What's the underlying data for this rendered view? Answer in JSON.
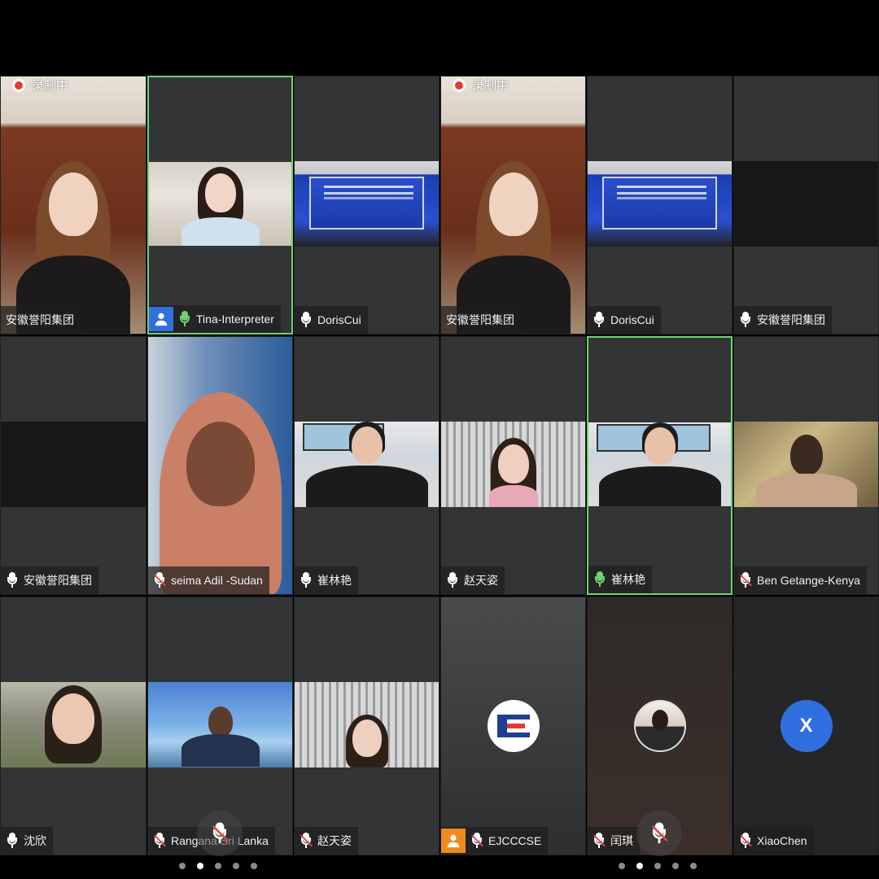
{
  "recording_label": "录制中",
  "colors": {
    "tile_bg": "#333436",
    "active_border": "#6fd36f",
    "muted_red": "#e04848",
    "badge_blue": "#2f6fe0",
    "badge_orange": "#f18a1e"
  },
  "left_panel": {
    "tiles": [
      {
        "name": "安徽誉阳集团",
        "mic": "on",
        "scene": "office-woman"
      },
      {
        "name": "Tina-Interpreter",
        "mic": "on-green",
        "scene": "shelf-woman",
        "badge": "user-icon"
      },
      {
        "name": "DorisCui",
        "mic": "on",
        "scene": "stage-banner"
      },
      {
        "name": "安徽誉阳集团",
        "mic": "on",
        "scene": "dark"
      },
      {
        "name": "seima Adil -Sudan",
        "mic": "muted",
        "scene": "hijab-woman"
      },
      {
        "name": "崔林艳",
        "mic": "on",
        "scene": "map-woman"
      },
      {
        "name": "沈欣",
        "mic": "on",
        "scene": "outdoor-woman"
      },
      {
        "name": "Rangana Sri Lanka",
        "mic": "muted",
        "scene": "sky-man"
      },
      {
        "name": "赵天姿",
        "mic": "muted",
        "scene": "ceiling-woman"
      }
    ],
    "pager": {
      "total": 5,
      "current": 2
    }
  },
  "right_panel": {
    "tiles": [
      {
        "name": "安徽誉阳集团",
        "mic": "none",
        "scene": "office-woman"
      },
      {
        "name": "DorisCui",
        "mic": "on",
        "scene": "stage-banner"
      },
      {
        "name": "安徽誉阳集团",
        "mic": "on",
        "scene": "dark"
      },
      {
        "name": "赵天姿",
        "mic": "on",
        "scene": "ceiling-woman"
      },
      {
        "name": "崔林艳",
        "mic": "on-green",
        "scene": "map-woman"
      },
      {
        "name": "Ben Getange-Kenya",
        "mic": "muted",
        "scene": "warm-man"
      },
      {
        "name": "EJCCCSE",
        "mic": "muted",
        "scene": "avatar-logo",
        "badge": "user-icon"
      },
      {
        "name": "闰琪",
        "mic": "muted",
        "scene": "avatar-photo"
      },
      {
        "name": "XiaoChen",
        "mic": "muted",
        "scene": "avatar-letter",
        "avatar_letter": "X"
      }
    ],
    "pager": {
      "total": 5,
      "current": 2
    }
  }
}
